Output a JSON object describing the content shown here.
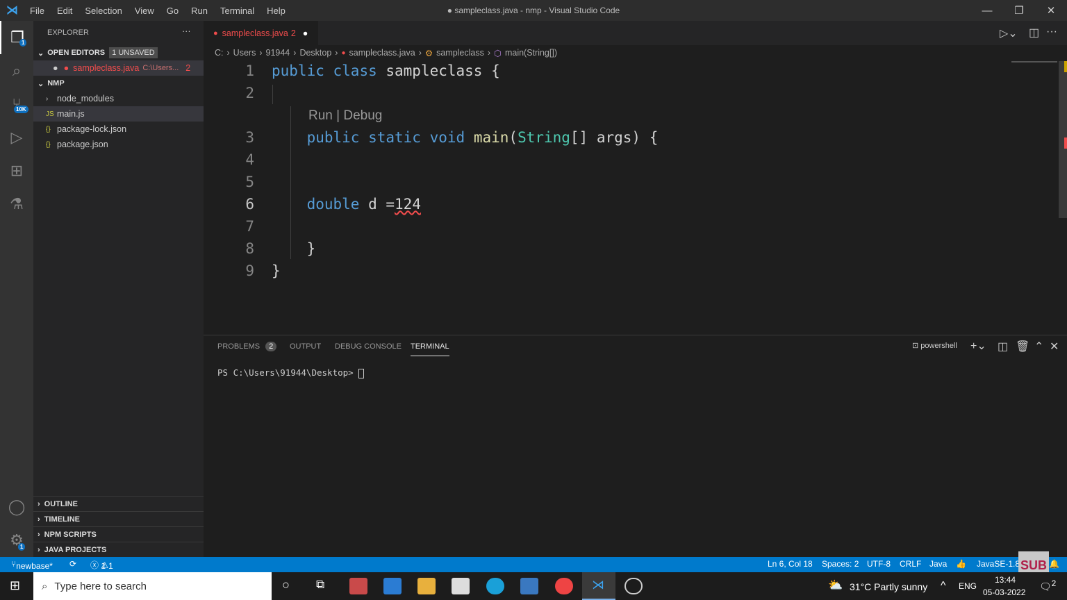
{
  "titlebar": {
    "menu": [
      "File",
      "Edit",
      "Selection",
      "View",
      "Go",
      "Run",
      "Terminal",
      "Help"
    ],
    "title": "● sampleclass.java - nmp - Visual Studio Code"
  },
  "activity": {
    "explorer_badge": "1",
    "scm_badge": "10K",
    "settings_badge": "1"
  },
  "sidebar": {
    "title": "EXPLORER",
    "more": "···",
    "open_editors": "OPEN EDITORS",
    "unsaved": "1 UNSAVED",
    "open_file": {
      "name": "sampleclass.java",
      "path": "C:\\Users...",
      "problems": "2"
    },
    "folder": "NMP",
    "items": [
      {
        "icon": "›",
        "label": "node_modules"
      },
      {
        "icon": "JS",
        "label": "main.js"
      },
      {
        "icon": "{}",
        "label": "package-lock.json"
      },
      {
        "icon": "{}",
        "label": "package.json"
      }
    ],
    "sections": [
      "OUTLINE",
      "TIMELINE",
      "NPM SCRIPTS",
      "JAVA PROJECTS"
    ]
  },
  "tab": {
    "name": "sampleclass.java",
    "problems": "2"
  },
  "breadcrumb": [
    "C:",
    "Users",
    "91944",
    "Desktop",
    "sampleclass.java",
    "sampleclass",
    "main(String[])"
  ],
  "editor": {
    "codelens": "Run | Debug",
    "lines": [
      {
        "n": "1",
        "tokens": [
          [
            "kw",
            "public "
          ],
          [
            "kw",
            "class "
          ],
          [
            "",
            "sampleclass {"
          ]
        ]
      },
      {
        "n": "2",
        "tokens": []
      },
      {
        "n": "3",
        "tokens": [
          [
            "",
            "    "
          ],
          [
            "kw",
            "public "
          ],
          [
            "kw",
            "static "
          ],
          [
            "kw",
            "void "
          ],
          [
            "fn",
            "main"
          ],
          [
            "",
            "("
          ],
          [
            "ty",
            "String"
          ],
          [
            "",
            "[] args) {"
          ]
        ]
      },
      {
        "n": "4",
        "tokens": []
      },
      {
        "n": "5",
        "tokens": []
      },
      {
        "n": "6",
        "tokens": [
          [
            "",
            "    "
          ],
          [
            "kw",
            "double "
          ],
          [
            "",
            "d ="
          ],
          [
            "",
            "124"
          ]
        ]
      },
      {
        "n": "7",
        "tokens": []
      },
      {
        "n": "8",
        "tokens": [
          [
            "",
            "    }"
          ]
        ]
      },
      {
        "n": "9",
        "tokens": [
          [
            "",
            "}"
          ]
        ]
      }
    ]
  },
  "panel": {
    "tabs": [
      "PROBLEMS",
      "OUTPUT",
      "DEBUG CONSOLE",
      "TERMINAL"
    ],
    "problems_count": "2",
    "shell": "powershell",
    "prompt": "PS C:\\Users\\91944\\Desktop> "
  },
  "status": {
    "branch": "newbase*",
    "errors": "1",
    "warnings": "1",
    "position": "Ln 6, Col 18",
    "spaces": "Spaces: 2",
    "encoding": "UTF-8",
    "eol": "CRLF",
    "language": "Java",
    "jdk": "JavaSE-1.8"
  },
  "taskbar": {
    "search": "Type here to search",
    "weather": "31°C  Partly sunny",
    "lang": "ENG",
    "time": "13:44",
    "date": "05-03-2022",
    "notifications": "2"
  },
  "watermark": "SUB",
  "colors": {
    "accent": "#007acc",
    "error": "#f14c4c",
    "keyword": "#569cd6",
    "type": "#4ec9b0"
  }
}
